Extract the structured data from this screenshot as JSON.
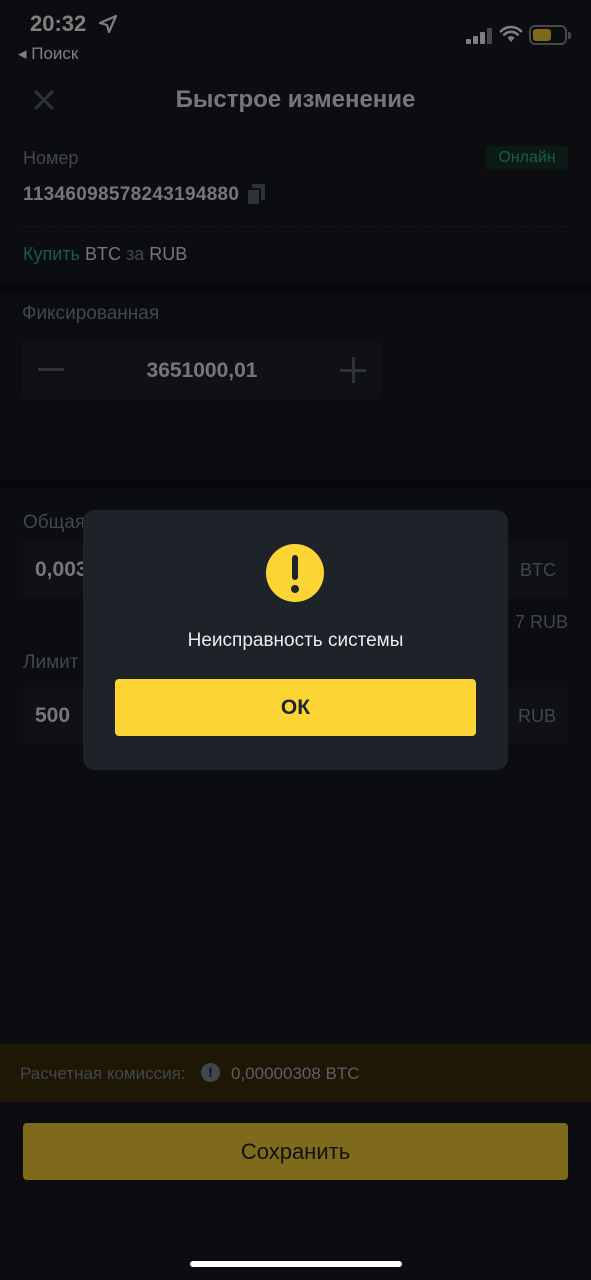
{
  "status_bar": {
    "time": "20:32",
    "back_label": "◂ Поиск"
  },
  "header": {
    "title": "Быстрое изменение"
  },
  "order": {
    "number_label": "Номер",
    "status_badge": "Онлайн",
    "number": "1134609857824319488​0",
    "trade": {
      "action": "Купить",
      "asset": "BTC",
      "for": "за",
      "fiat": "RUB"
    }
  },
  "price": {
    "label": "Фиксированная",
    "value": "3651000,01"
  },
  "total": {
    "label": "Общая",
    "value": "0,003",
    "unit": "BTC",
    "rub_tail": "7 RUB"
  },
  "limit": {
    "label": "Лимит",
    "value": "500",
    "unit": "RUB"
  },
  "commission": {
    "label": "Расчетная комиссия:",
    "info_icon": "!",
    "value": "0,00000308 BTC"
  },
  "save_button": "Сохранить",
  "dialog": {
    "icon": "warning-icon",
    "message": "Неисправность системы",
    "ok_label": "ОК"
  },
  "colors": {
    "accent": "#fcd535",
    "online": "#2ebd85",
    "background": "#181a20"
  }
}
